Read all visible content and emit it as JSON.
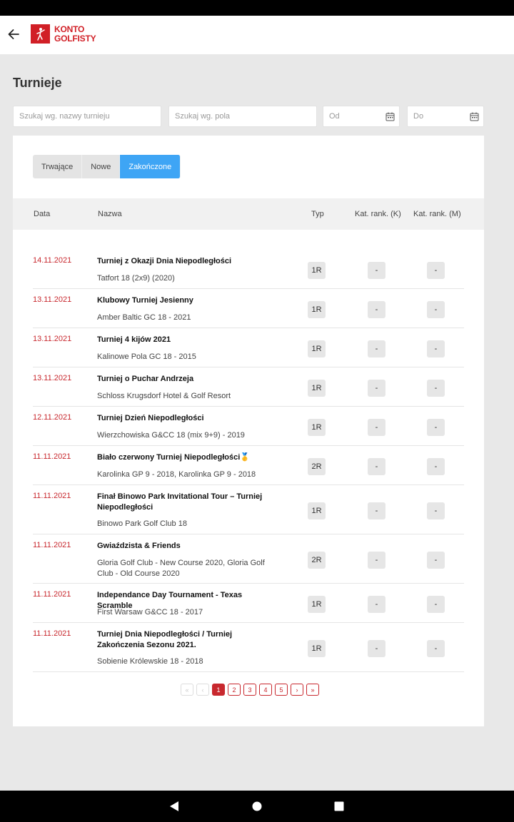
{
  "header": {
    "logo_line1": "KONTO",
    "logo_line2": "GOLFISTY",
    "brand_color": "#d11f26"
  },
  "page": {
    "title": "Turnieje"
  },
  "filters": {
    "name_placeholder": "Szukaj wg. nazwy turnieju",
    "course_placeholder": "Szukaj wg. pola",
    "from_placeholder": "Od",
    "to_placeholder": "Do"
  },
  "tabs": [
    {
      "label": "Trwające",
      "active": false
    },
    {
      "label": "Nowe",
      "active": false
    },
    {
      "label": "Zakończone",
      "active": true
    }
  ],
  "columns": {
    "date": "Data",
    "name": "Nazwa",
    "type": "Typ",
    "rank_k": "Kat. rank. (K)",
    "rank_m": "Kat. rank. (M)"
  },
  "rows": [
    {
      "date": "14.11.2021",
      "name": "Turniej z Okazji Dnia Niepodległości",
      "course": "Tatfort 18 (2x9) (2020)",
      "type": "1R",
      "rank_k": "-",
      "rank_m": "-"
    },
    {
      "date": "13.11.2021",
      "name": "Klubowy Turniej Jesienny",
      "course": "Amber Baltic GC 18 - 2021",
      "type": "1R",
      "rank_k": "-",
      "rank_m": "-"
    },
    {
      "date": "13.11.2021",
      "name": "Turniej 4 kijów 2021",
      "course": "Kalinowe Pola GC 18 - 2015",
      "type": "1R",
      "rank_k": "-",
      "rank_m": "-"
    },
    {
      "date": "13.11.2021",
      "name": "Turniej o Puchar Andrzeja",
      "course": "Schloss Krugsdorf Hotel & Golf Resort",
      "type": "1R",
      "rank_k": "-",
      "rank_m": "-"
    },
    {
      "date": "12.11.2021",
      "name": "Turniej Dzień Niepodległości",
      "course": "Wierzchowiska G&CC 18 (mix 9+9) - 2019",
      "type": "1R",
      "rank_k": "-",
      "rank_m": "-"
    },
    {
      "date": "11.11.2021",
      "name": "Biało czerwony Turniej Niepodległości🥇",
      "course": "Karolinka GP 9 - 2018, Karolinka GP 9 - 2018",
      "type": "2R",
      "rank_k": "-",
      "rank_m": "-"
    },
    {
      "date": "11.11.2021",
      "name": "Finał Binowo Park Invitational Tour – Turniej Niepodległości",
      "course": "Binowo Park Golf Club 18",
      "type": "1R",
      "rank_k": "-",
      "rank_m": "-"
    },
    {
      "date": "11.11.2021",
      "name": "Gwiaździsta & Friends",
      "course": "Gloria Golf Club - New Course 2020, Gloria Golf Club - Old Course 2020",
      "type": "2R",
      "rank_k": "-",
      "rank_m": "-"
    },
    {
      "date": "11.11.2021",
      "name": "Independance Day Tournament - Texas Scramble",
      "course": "First Warsaw G&CC 18 - 2017",
      "type": "1R",
      "rank_k": "-",
      "rank_m": "-"
    },
    {
      "date": "11.11.2021",
      "name": "Turniej Dnia Niepodległości / Turniej Zakończenia Sezonu 2021.",
      "course": "Sobienie Królewskie 18 - 2018",
      "type": "1R",
      "rank_k": "-",
      "rank_m": "-"
    }
  ],
  "pagination": {
    "first": "«",
    "prev": "‹",
    "pages": [
      "1",
      "2",
      "3",
      "4",
      "5"
    ],
    "current": "1",
    "next": "›",
    "last": "»"
  }
}
